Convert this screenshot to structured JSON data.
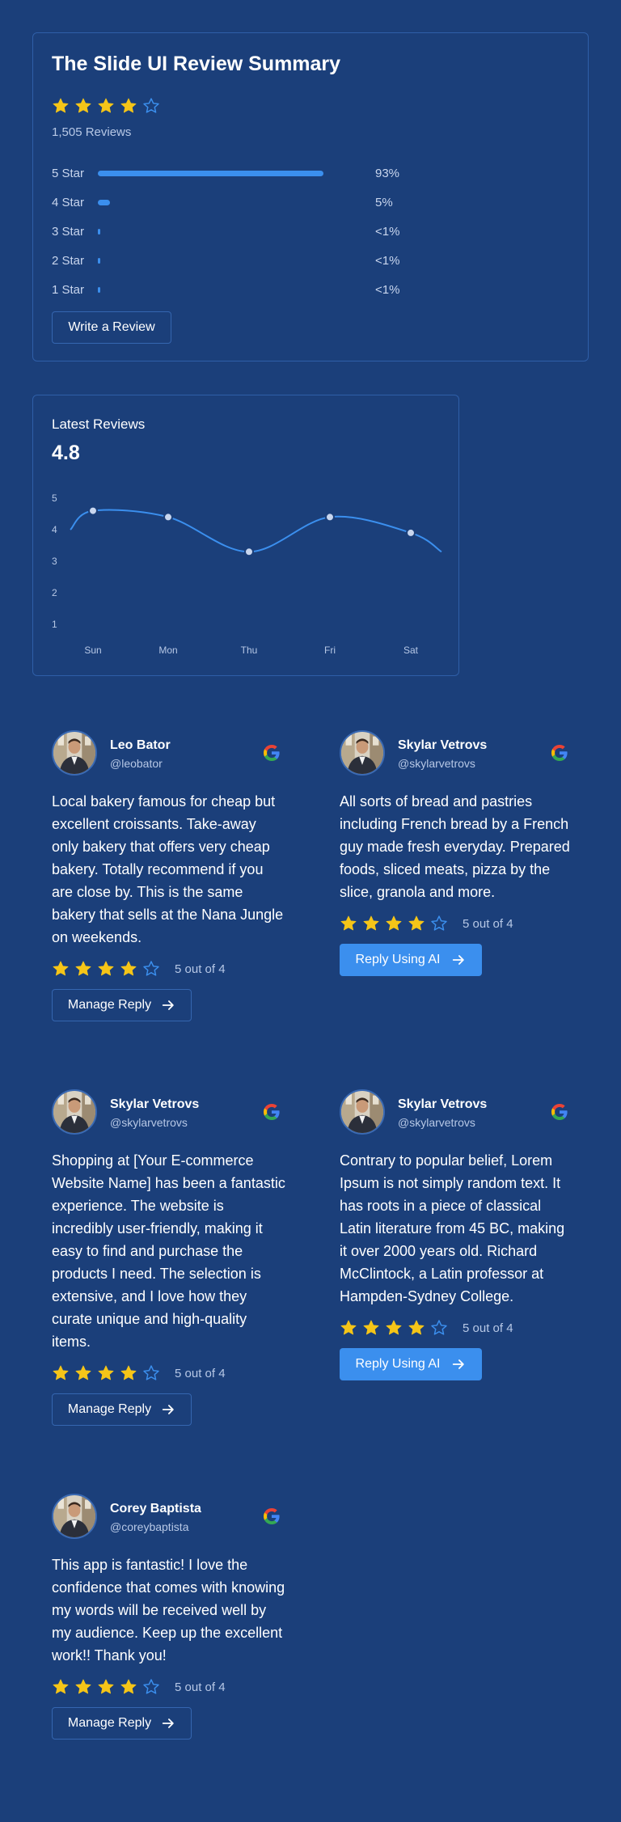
{
  "summary": {
    "title": "The Slide UI Review Summary",
    "rating_stars": 4,
    "max_stars": 5,
    "review_count": "1,505 Reviews",
    "bars": [
      {
        "label": "5 Star",
        "pct_text": "93%",
        "fill": 0.93
      },
      {
        "label": "4 Star",
        "pct_text": "5%",
        "fill": 0.05
      },
      {
        "label": "3 Star",
        "pct_text": "<1%",
        "fill": 0.008
      },
      {
        "label": "2 Star",
        "pct_text": "<1%",
        "fill": 0.008
      },
      {
        "label": "1 Star",
        "pct_text": "<1%",
        "fill": 0.008
      }
    ],
    "write_button": "Write a Review"
  },
  "latest": {
    "title": "Latest Reviews",
    "score": "4.8",
    "chart_data": {
      "type": "line",
      "categories": [
        "Sun",
        "Mon",
        "Thu",
        "Fri",
        "Sat"
      ],
      "values": [
        4.6,
        4.4,
        3.3,
        4.4,
        3.9
      ],
      "ylim": [
        1,
        5
      ],
      "yticks": [
        "1",
        "2",
        "3",
        "4",
        "5"
      ]
    }
  },
  "reviews": [
    {
      "name": "Leo Bator",
      "handle": "@leobator",
      "text": "Local bakery famous for cheap but excellent croissants. Take-away only bakery that offers very cheap bakery. Totally recommend if you are close by. This is the same bakery that sells at the Nana Jungle on weekends.",
      "stars": 4,
      "rating_text": "5 out of 4",
      "button": "Manage Reply",
      "button_type": "manage"
    },
    {
      "name": "Skylar Vetrovs",
      "handle": "@skylarvetrovs",
      "text": "All sorts of bread and pastries including French bread by a French guy made fresh everyday. Prepared foods, sliced meats, pizza by the slice, granola and more.",
      "stars": 4,
      "rating_text": "5 out of 4",
      "button": "Reply Using AI",
      "button_type": "ai"
    },
    {
      "name": "Skylar Vetrovs",
      "handle": "@skylarvetrovs",
      "text": "Shopping at [Your E-commerce Website Name] has been a fantastic experience. The website is incredibly user-friendly, making it easy to find and purchase the products I need. The selection is extensive, and I love how they curate unique and high-quality items.",
      "stars": 4,
      "rating_text": "5 out of 4",
      "button": "Manage Reply",
      "button_type": "manage"
    },
    {
      "name": "Skylar Vetrovs",
      "handle": "@skylarvetrovs",
      "text": "Contrary to popular belief, Lorem Ipsum is not simply random text. It has roots in a piece of classical Latin literature from 45 BC, making it over 2000 years old. Richard McClintock, a Latin professor at Hampden-Sydney College.",
      "stars": 4,
      "rating_text": "5 out of 4",
      "button": "Reply Using AI",
      "button_type": "ai"
    },
    {
      "name": "Corey Baptista",
      "handle": "@coreybaptista",
      "text": "This app is fantastic! I love the confidence that comes with knowing my words will be received well by my audience. Keep up the excellent work!! Thank you!",
      "stars": 4,
      "rating_text": "5 out of 4",
      "button": "Manage Reply",
      "button_type": "manage"
    }
  ],
  "colors": {
    "background": "#1b3f7a",
    "accent": "#3b8fee",
    "star": "#f5c518",
    "card_border": "#2f5fa8"
  }
}
